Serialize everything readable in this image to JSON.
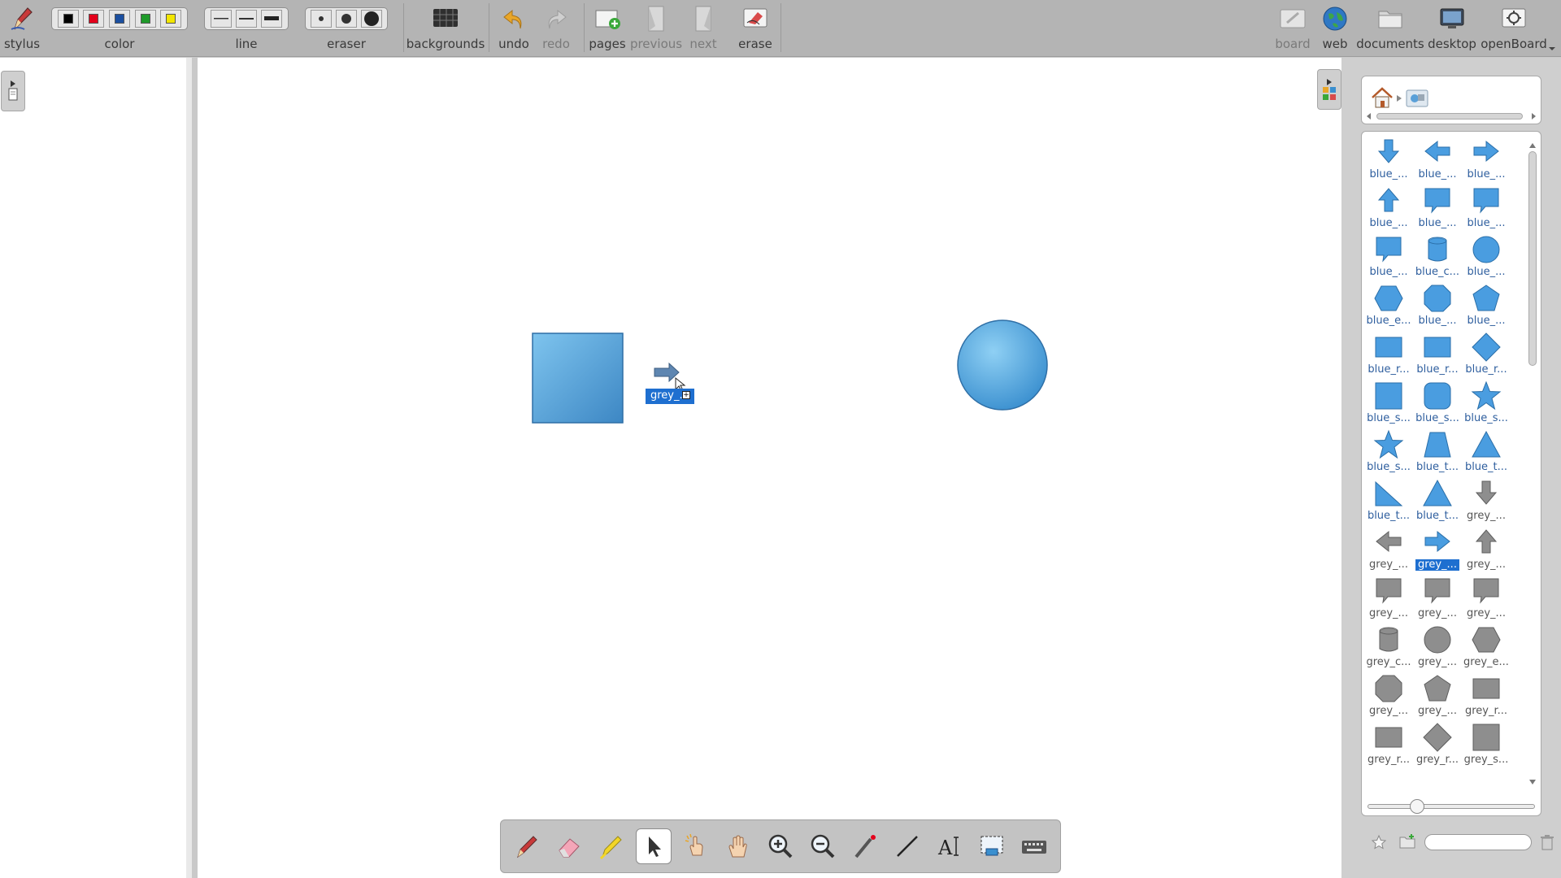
{
  "toolbar": {
    "stylus": "stylus",
    "color": "color",
    "line": "line",
    "eraser": "eraser",
    "backgrounds": "backgrounds",
    "undo": "undo",
    "redo": "redo",
    "pages": "pages",
    "previous": "previous",
    "next": "next",
    "erase": "erase",
    "board": "board",
    "web": "web",
    "documents": "documents",
    "desktop": "desktop",
    "openboard": "openBoard",
    "colors": [
      "#000000",
      "#e3001b",
      "#1b4fa0",
      "#1f9a2a",
      "#f2e600"
    ]
  },
  "board": {
    "drag_label": "grey_..."
  },
  "library": {
    "search_placeholder": "",
    "items": [
      {
        "label": "blue_...",
        "shape": "arrow-down",
        "tone": "blue"
      },
      {
        "label": "blue_...",
        "shape": "arrow-left",
        "tone": "blue"
      },
      {
        "label": "blue_...",
        "shape": "arrow-right",
        "tone": "blue"
      },
      {
        "label": "blue_...",
        "shape": "arrow-up",
        "tone": "blue"
      },
      {
        "label": "blue_...",
        "shape": "callout",
        "tone": "blue"
      },
      {
        "label": "blue_...",
        "shape": "callout",
        "tone": "blue"
      },
      {
        "label": "blue_...",
        "shape": "callout",
        "tone": "blue"
      },
      {
        "label": "blue_c...",
        "shape": "cylinder",
        "tone": "blue"
      },
      {
        "label": "blue_...",
        "shape": "circle",
        "tone": "blue"
      },
      {
        "label": "blue_e...",
        "shape": "hexagon",
        "tone": "blue"
      },
      {
        "label": "blue_...",
        "shape": "octagon",
        "tone": "blue"
      },
      {
        "label": "blue_...",
        "shape": "pentagon",
        "tone": "blue"
      },
      {
        "label": "blue_r...",
        "shape": "rect",
        "tone": "blue"
      },
      {
        "label": "blue_r...",
        "shape": "rect",
        "tone": "blue"
      },
      {
        "label": "blue_r...",
        "shape": "diamond",
        "tone": "blue"
      },
      {
        "label": "blue_s...",
        "shape": "square",
        "tone": "blue"
      },
      {
        "label": "blue_s...",
        "shape": "rounded",
        "tone": "blue"
      },
      {
        "label": "blue_s...",
        "shape": "star",
        "tone": "blue"
      },
      {
        "label": "blue_s...",
        "shape": "star",
        "tone": "blue"
      },
      {
        "label": "blue_t...",
        "shape": "trapezoid",
        "tone": "blue"
      },
      {
        "label": "blue_t...",
        "shape": "triangle",
        "tone": "blue"
      },
      {
        "label": "blue_t...",
        "shape": "right-triangle",
        "tone": "blue"
      },
      {
        "label": "blue_t...",
        "shape": "triangle",
        "tone": "blue"
      },
      {
        "label": "grey_...",
        "shape": "arrow-down",
        "tone": "grey"
      },
      {
        "label": "grey_...",
        "shape": "arrow-left",
        "tone": "grey"
      },
      {
        "label": "grey_...",
        "shape": "arrow-right",
        "tone": "blue",
        "selected": true
      },
      {
        "label": "grey_...",
        "shape": "arrow-up",
        "tone": "grey"
      },
      {
        "label": "grey_...",
        "shape": "callout",
        "tone": "grey"
      },
      {
        "label": "grey_...",
        "shape": "callout",
        "tone": "grey"
      },
      {
        "label": "grey_...",
        "shape": "callout",
        "tone": "grey"
      },
      {
        "label": "grey_c...",
        "shape": "cylinder",
        "tone": "grey"
      },
      {
        "label": "grey_...",
        "shape": "circle",
        "tone": "grey"
      },
      {
        "label": "grey_e...",
        "shape": "hexagon",
        "tone": "grey"
      },
      {
        "label": "grey_...",
        "shape": "octagon",
        "tone": "grey"
      },
      {
        "label": "grey_...",
        "shape": "pentagon",
        "tone": "grey"
      },
      {
        "label": "grey_r...",
        "shape": "rect",
        "tone": "grey"
      },
      {
        "label": "grey_r...",
        "shape": "rect",
        "tone": "grey"
      },
      {
        "label": "grey_r...",
        "shape": "diamond",
        "tone": "grey"
      },
      {
        "label": "grey_s...",
        "shape": "square",
        "tone": "grey"
      }
    ]
  }
}
